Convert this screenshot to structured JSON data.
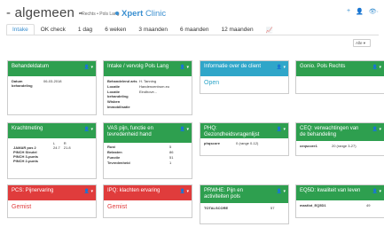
{
  "header": {
    "title": "- algemeen -",
    "breadcrumb": "• Rechts • Pols Lang",
    "app": "Xpert",
    "app_suffix": "Clinic"
  },
  "top_icons": [
    "+",
    "👤",
    "👁·"
  ],
  "tabs": [
    "Intake",
    "OK check",
    "1 dag",
    "6 weken",
    "3 maanden",
    "6 maanden",
    "12 maanden",
    "📈"
  ],
  "filter": "Alle",
  "cards": {
    "behandeldatum": {
      "title": "Behandeldatum",
      "label": "Datum behandeling",
      "value": "06-03-2018"
    },
    "intake": {
      "title": "Intake / vervolg Pols Lang",
      "rows": [
        [
          "Behandelend arts",
          "H. Tanning"
        ],
        [
          "Locatie",
          "Handencentrum.eu"
        ],
        [
          "Locatie behandeling",
          "Eindhove..."
        ],
        [
          "Wisben",
          ""
        ],
        [
          "Immobilisatie",
          ""
        ]
      ]
    },
    "client": {
      "title": "Informatie over de client",
      "value": "Open"
    },
    "gonio": {
      "title": "Gonio. Pols Rechts"
    },
    "kracht": {
      "title": "Krachtmeting",
      "cols": [
        "",
        "L",
        "R"
      ],
      "rows": [
        [
          "JAMAR pos 2",
          "24.7",
          "21.8"
        ],
        [
          "PINCH Sleutel",
          "",
          ""
        ],
        [
          "PINCH 3-punts",
          "",
          ""
        ],
        [
          "PINCH 2-punts",
          "",
          ""
        ]
      ]
    },
    "vas": {
      "title": "VAS pijn, functie en tevredenheid hand",
      "rows": [
        [
          "Rust",
          "5"
        ],
        [
          "Belasten",
          "86"
        ],
        [
          "Functie",
          "51"
        ],
        [
          "Tevredenheid",
          "1"
        ]
      ]
    },
    "phq": {
      "title": "PHQ: Gezondheidsvragenlijst",
      "label": "phqscore",
      "value": "0 (range 0-12)"
    },
    "ceq": {
      "title": "CEQ: verwachtingen van de behandeling",
      "label": "ceqscore1",
      "value": "20 (range 3-27)"
    },
    "pcs": {
      "title": "PCS: Pijnervaring",
      "value": "Gemist"
    },
    "ipq": {
      "title": "IPQ: klachten ervaring",
      "value": "Gemist"
    },
    "prwhe": {
      "title": "PRWHE: Pijn en activiteiten pols",
      "label": "TOTALSCORE",
      "value": "57"
    },
    "eq5d": {
      "title": "EQ5D: kwaliteit van leven",
      "label": "mastlot_EQ5D1",
      "value": "49"
    }
  },
  "colors": {
    "green": "#2e9f4f",
    "blue": "#2fa6c9",
    "red": "#e03c3c",
    "accent": "#3a8fd0"
  }
}
